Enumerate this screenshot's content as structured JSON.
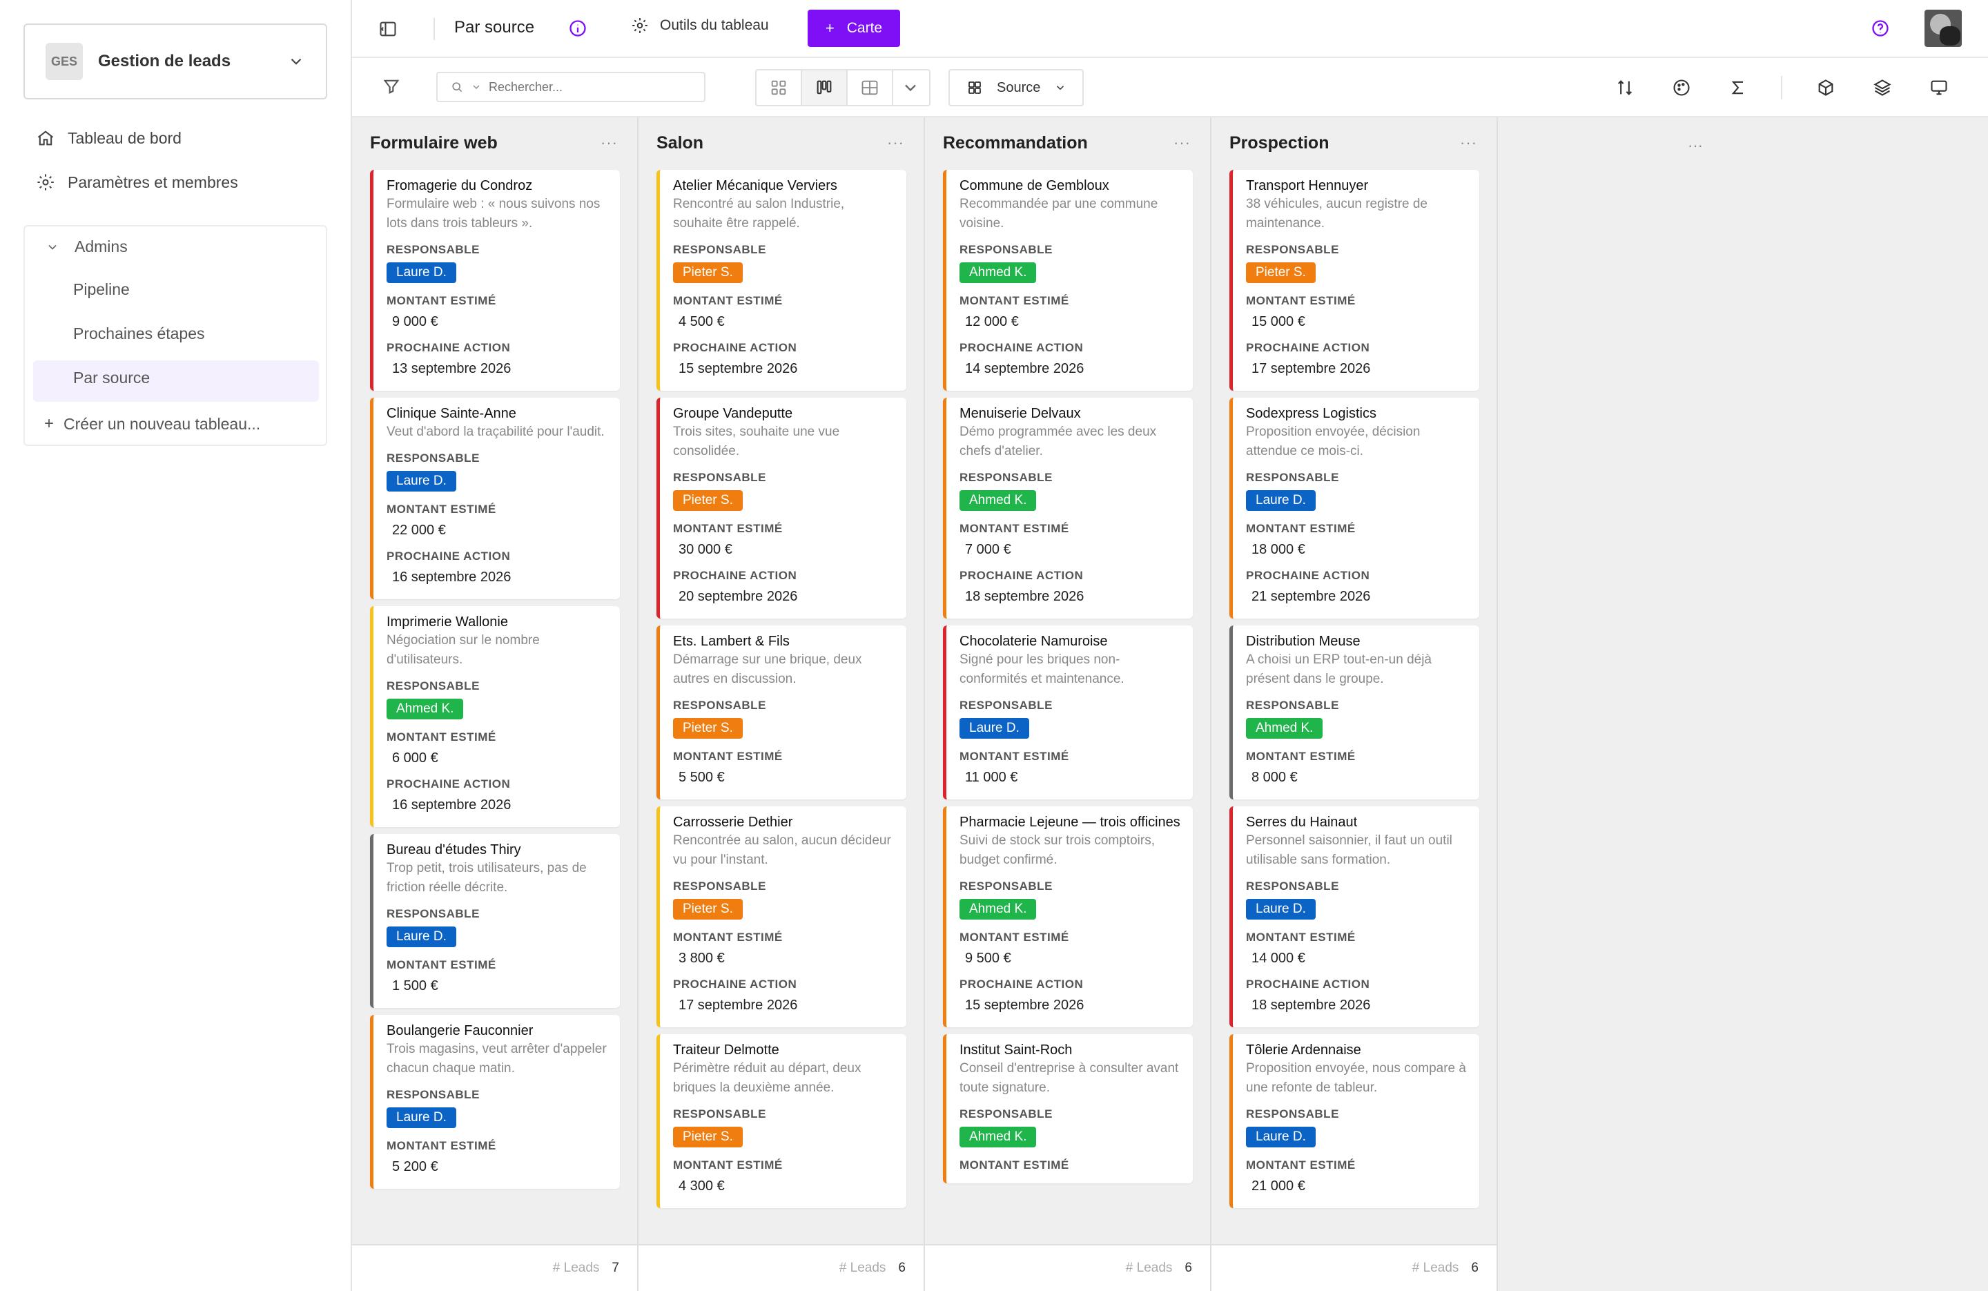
{
  "sidebar": {
    "workspace_badge": "GES",
    "workspace_name": "Gestion de leads",
    "nav": [
      {
        "label": "Tableau de bord"
      },
      {
        "label": "Paramètres et membres"
      }
    ],
    "group_label": "Admins",
    "boards": [
      {
        "label": "Pipeline"
      },
      {
        "label": "Prochaines étapes"
      },
      {
        "label": "Par source"
      }
    ],
    "create_label": "Créer un nouveau tableau..."
  },
  "header": {
    "title": "Par source",
    "tools_label": "Outils du tableau",
    "add_card_label": "Carte"
  },
  "toolbar": {
    "search_placeholder": "Rechercher...",
    "group_by_label": "Source"
  },
  "colors": {
    "accent": "#7f10f5",
    "red": "#d9252b",
    "orange": "#f07d10",
    "yellow": "#f7c21c",
    "gray": "#6b6b6b",
    "blue": "#0b63c5",
    "green": "#1fb54b"
  },
  "fields": {
    "owner": "RESPONSABLE",
    "amount": "MONTANT ESTIMÉ",
    "next": "PROCHAINE ACTION"
  },
  "footer_label": "# Leads",
  "columns": [
    {
      "title": "Formulaire web",
      "count": "7",
      "cards": [
        {
          "name": "Fromagerie du Condroz",
          "desc": "Formulaire web : « nous suivons nos lots dans trois tableurs ».",
          "owner": "Laure D.",
          "amount": "9 000 €",
          "next": "13 septembre 2026",
          "stripe": "red",
          "owner_color": "blue"
        },
        {
          "name": "Clinique Sainte-Anne",
          "desc": "Veut d'abord la traçabilité pour l'audit.",
          "owner": "Laure D.",
          "amount": "22 000 €",
          "next": "16 septembre 2026",
          "stripe": "orange",
          "owner_color": "blue"
        },
        {
          "name": "Imprimerie Wallonie",
          "desc": "Négociation sur le nombre d'utilisateurs.",
          "owner": "Ahmed K.",
          "amount": "6 000 €",
          "next": "16 septembre 2026",
          "stripe": "yellow",
          "owner_color": "green"
        },
        {
          "name": "Bureau d'études Thiry",
          "desc": "Trop petit, trois utilisateurs, pas de friction réelle décrite.",
          "owner": "Laure D.",
          "amount": "1 500 €",
          "next": "",
          "stripe": "gray",
          "owner_color": "blue"
        },
        {
          "name": "Boulangerie Fauconnier",
          "desc": "Trois magasins, veut arrêter d'appeler chacun chaque matin.",
          "owner": "Laure D.",
          "amount": "5 200 €",
          "next": "",
          "stripe": "orange",
          "owner_color": "blue"
        }
      ]
    },
    {
      "title": "Salon",
      "count": "6",
      "cards": [
        {
          "name": "Atelier Mécanique Verviers",
          "desc": "Rencontré au salon Industrie, souhaite être rappelé.",
          "owner": "Pieter S.",
          "amount": "4 500 €",
          "next": "15 septembre 2026",
          "stripe": "yellow",
          "owner_color": "orange"
        },
        {
          "name": "Groupe Vandeputte",
          "desc": "Trois sites, souhaite une vue consolidée.",
          "owner": "Pieter S.",
          "amount": "30 000 €",
          "next": "20 septembre 2026",
          "stripe": "red",
          "owner_color": "orange"
        },
        {
          "name": "Ets. Lambert & Fils",
          "desc": "Démarrage sur une brique, deux autres en discussion.",
          "owner": "Pieter S.",
          "amount": "5 500 €",
          "next": "",
          "stripe": "orange",
          "owner_color": "orange"
        },
        {
          "name": "Carrosserie Dethier",
          "desc": "Rencontrée au salon, aucun décideur vu pour l'instant.",
          "owner": "Pieter S.",
          "amount": "3 800 €",
          "next": "17 septembre 2026",
          "stripe": "yellow",
          "owner_color": "orange"
        },
        {
          "name": "Traiteur Delmotte",
          "desc": "Périmètre réduit au départ, deux briques la deuxième année.",
          "owner": "Pieter S.",
          "amount": "4 300 €",
          "next": "",
          "stripe": "yellow",
          "owner_color": "orange"
        }
      ]
    },
    {
      "title": "Recommandation",
      "count": "6",
      "cards": [
        {
          "name": "Commune de Gembloux",
          "desc": "Recommandée par une commune voisine.",
          "owner": "Ahmed K.",
          "amount": "12 000 €",
          "next": "14 septembre 2026",
          "stripe": "orange",
          "owner_color": "green"
        },
        {
          "name": "Menuiserie Delvaux",
          "desc": "Démo programmée avec les deux chefs d'atelier.",
          "owner": "Ahmed K.",
          "amount": "7 000 €",
          "next": "18 septembre 2026",
          "stripe": "orange",
          "owner_color": "green"
        },
        {
          "name": "Chocolaterie Namuroise",
          "desc": "Signé pour les briques non-conformités et maintenance.",
          "owner": "Laure D.",
          "amount": "11 000 €",
          "next": "",
          "stripe": "red",
          "owner_color": "blue"
        },
        {
          "name": "Pharmacie Lejeune — trois officines",
          "desc": "Suivi de stock sur trois comptoirs, budget confirmé.",
          "owner": "Ahmed K.",
          "amount": "9 500 €",
          "next": "15 septembre 2026",
          "stripe": "orange",
          "owner_color": "green"
        },
        {
          "name": "Institut Saint-Roch",
          "desc": "Conseil d'entreprise à consulter avant toute signature.",
          "owner": "Ahmed K.",
          "amount": "",
          "next": "",
          "stripe": "orange",
          "owner_color": "green"
        }
      ]
    },
    {
      "title": "Prospection",
      "count": "6",
      "cards": [
        {
          "name": "Transport Hennuyer",
          "desc": "38 véhicules, aucun registre de maintenance.",
          "owner": "Pieter S.",
          "amount": "15 000 €",
          "next": "17 septembre 2026",
          "stripe": "red",
          "owner_color": "orange"
        },
        {
          "name": "Sodexpress Logistics",
          "desc": "Proposition envoyée, décision attendue ce mois-ci.",
          "owner": "Laure D.",
          "amount": "18 000 €",
          "next": "21 septembre 2026",
          "stripe": "orange",
          "owner_color": "blue"
        },
        {
          "name": "Distribution Meuse",
          "desc": "A choisi un ERP tout-en-un déjà présent dans le groupe.",
          "owner": "Ahmed K.",
          "amount": "8 000 €",
          "next": "",
          "stripe": "gray",
          "owner_color": "green"
        },
        {
          "name": "Serres du Hainaut",
          "desc": "Personnel saisonnier, il faut un outil utilisable sans formation.",
          "owner": "Laure D.",
          "amount": "14 000 €",
          "next": "18 septembre 2026",
          "stripe": "red",
          "owner_color": "blue"
        },
        {
          "name": "Tôlerie Ardennaise",
          "desc": "Proposition envoyée, nous compare à une refonte de tableur.",
          "owner": "Laure D.",
          "amount": "21 000 €",
          "next": "",
          "stripe": "orange",
          "owner_color": "blue"
        }
      ]
    }
  ]
}
